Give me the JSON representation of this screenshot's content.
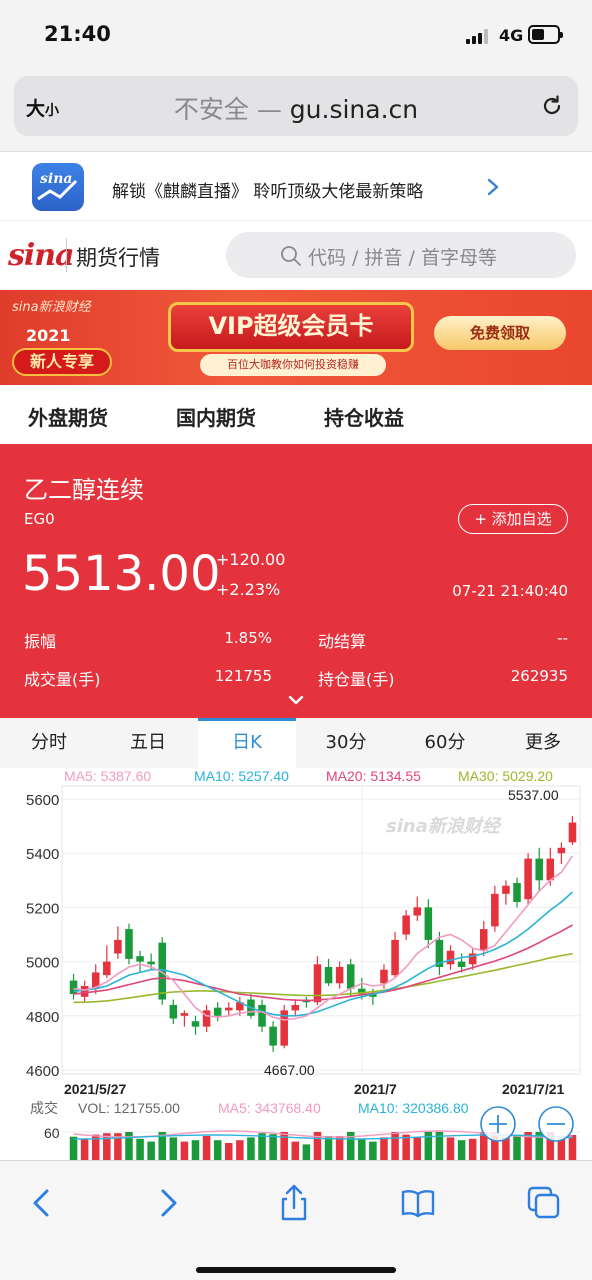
{
  "status_bar": {
    "time": "21:40",
    "network": "4G"
  },
  "browser": {
    "text_size_label": "大",
    "text_size_small": "小",
    "url_insecure": "不安全 —",
    "url_domain": "gu.sina.cn"
  },
  "promo_banner": {
    "text": "解锁《麒麟直播》 聆听顶级大佬最新策略"
  },
  "site_header": {
    "logo": "sina",
    "title": "期货行情",
    "search_placeholder": "代码 / 拼音 / 首字母等"
  },
  "ad_banner": {
    "brand": "sina新浪财经",
    "year": "2021",
    "newbie": "新人专享",
    "headline": "VIP超级会员卡",
    "subline": "百位大咖教你如何投资稳赚",
    "cta": "免费领取"
  },
  "main_tabs": [
    "外盘期货",
    "国内期货",
    "持仓收益"
  ],
  "quote": {
    "name": "乙二醇连续",
    "code": "EG0",
    "add_watch": "+ 添加自选",
    "price": "5513.00",
    "change": "+120.00",
    "change_pct": "+2.23%",
    "datetime": "07-21 21:40:40",
    "amplitude_label": "振幅",
    "amplitude": "1.85%",
    "settle_label": "动结算",
    "settle": "--",
    "volume_label": "成交量(手)",
    "volume": "121755",
    "open_interest_label": "持仓量(手)",
    "open_interest": "262935"
  },
  "period_tabs": [
    "分时",
    "五日",
    "日K",
    "30分",
    "60分",
    "更多"
  ],
  "active_period": "日K",
  "colors": {
    "up": "#e5333d",
    "down": "#1a9a3a",
    "ma5": "#f29ac0",
    "ma10": "#2bb3d8",
    "ma20": "#e0457b",
    "ma30": "#9ab82a",
    "accent": "#2f8dd8"
  },
  "chart_data": {
    "type": "candlestick",
    "ma_legend": [
      {
        "name": "MA5",
        "text": "MA5: 5387.60"
      },
      {
        "name": "MA10",
        "text": "MA10: 5257.40"
      },
      {
        "name": "MA20",
        "text": "MA20: 5134.55"
      },
      {
        "name": "MA30",
        "text": "MA30: 5029.20"
      }
    ],
    "y_ticks": [
      5600,
      5400,
      5200,
      5000,
      4800,
      4600
    ],
    "ylim": [
      4600,
      5650
    ],
    "x_labels": [
      "2021/5/27",
      "2021/7",
      "2021/7/21"
    ],
    "max_label": "5537.00",
    "min_label": "4667.00",
    "watermark": "sina新浪财经",
    "candles": [
      [
        4930,
        4880,
        4955,
        4860
      ],
      [
        4870,
        4910,
        4930,
        4850
      ],
      [
        4900,
        4960,
        4990,
        4880
      ],
      [
        4950,
        5000,
        5060,
        4940
      ],
      [
        5030,
        5080,
        5130,
        5010
      ],
      [
        5120,
        5010,
        5140,
        4990
      ],
      [
        5020,
        5000,
        5040,
        4960
      ],
      [
        5000,
        4990,
        5030,
        4970
      ],
      [
        5070,
        4860,
        5090,
        4840
      ],
      [
        4840,
        4790,
        4860,
        4770
      ],
      [
        4800,
        4810,
        4820,
        4760
      ],
      [
        4780,
        4760,
        4800,
        4730
      ],
      [
        4760,
        4820,
        4840,
        4740
      ],
      [
        4830,
        4800,
        4850,
        4780
      ],
      [
        4820,
        4830,
        4850,
        4800
      ],
      [
        4820,
        4850,
        4870,
        4800
      ],
      [
        4860,
        4800,
        4880,
        4790
      ],
      [
        4840,
        4760,
        4860,
        4740
      ],
      [
        4760,
        4690,
        4780,
        4667
      ],
      [
        4690,
        4820,
        4840,
        4680
      ],
      [
        4820,
        4840,
        4860,
        4800
      ],
      [
        4860,
        4850,
        4870,
        4830
      ],
      [
        4850,
        4990,
        5020,
        4840
      ],
      [
        4980,
        4920,
        5010,
        4910
      ],
      [
        4920,
        4980,
        5000,
        4900
      ],
      [
        4990,
        4900,
        5010,
        4870
      ],
      [
        4900,
        4880,
        4940,
        4860
      ],
      [
        4880,
        4870,
        4900,
        4840
      ],
      [
        4920,
        4970,
        4990,
        4900
      ],
      [
        4950,
        5080,
        5110,
        4940
      ],
      [
        5100,
        5170,
        5190,
        5080
      ],
      [
        5170,
        5200,
        5240,
        5150
      ],
      [
        5200,
        5080,
        5230,
        5050
      ],
      [
        5080,
        4980,
        5110,
        4950
      ],
      [
        4990,
        5040,
        5060,
        4970
      ],
      [
        5000,
        4980,
        5030,
        4960
      ],
      [
        4990,
        5030,
        5050,
        4970
      ],
      [
        5040,
        5120,
        5150,
        5020
      ],
      [
        5130,
        5250,
        5280,
        5110
      ],
      [
        5250,
        5280,
        5300,
        5210
      ],
      [
        5290,
        5220,
        5310,
        5200
      ],
      [
        5230,
        5380,
        5400,
        5210
      ],
      [
        5380,
        5300,
        5420,
        5260
      ],
      [
        5300,
        5380,
        5420,
        5280
      ],
      [
        5400,
        5420,
        5440,
        5360
      ],
      [
        5440,
        5513,
        5537,
        5430
      ]
    ],
    "ma5": [
      4900,
      4895,
      4905,
      4925,
      4955,
      4980,
      4990,
      4980,
      4960,
      4930,
      4880,
      4830,
      4800,
      4795,
      4800,
      4810,
      4815,
      4815,
      4795,
      4785,
      4790,
      4800,
      4830,
      4860,
      4880,
      4900,
      4920,
      4910,
      4915,
      4940,
      4980,
      5030,
      5060,
      5090,
      5100,
      5080,
      5050,
      5040,
      5060,
      5110,
      5160,
      5210,
      5260,
      5300,
      5330,
      5390
    ],
    "ma10": [
      4890,
      4895,
      4900,
      4910,
      4930,
      4950,
      4960,
      4970,
      4970,
      4960,
      4950,
      4930,
      4910,
      4890,
      4870,
      4850,
      4830,
      4815,
      4805,
      4800,
      4800,
      4805,
      4815,
      4830,
      4845,
      4860,
      4870,
      4880,
      4890,
      4905,
      4925,
      4950,
      4975,
      4995,
      5005,
      5015,
      5020,
      5030,
      5045,
      5065,
      5090,
      5120,
      5155,
      5190,
      5220,
      5257
    ],
    "ma20": [
      4880,
      4885,
      4890,
      4895,
      4905,
      4915,
      4925,
      4935,
      4940,
      4935,
      4930,
      4920,
      4910,
      4900,
      4890,
      4880,
      4875,
      4870,
      4865,
      4860,
      4858,
      4856,
      4858,
      4862,
      4866,
      4872,
      4878,
      4882,
      4888,
      4896,
      4906,
      4918,
      4930,
      4942,
      4954,
      4966,
      4978,
      4990,
      5002,
      5016,
      5032,
      5050,
      5070,
      5092,
      5112,
      5135
    ],
    "ma30": [
      4850,
      4850,
      4852,
      4855,
      4860,
      4866,
      4872,
      4878,
      4884,
      4888,
      4890,
      4892,
      4892,
      4890,
      4888,
      4886,
      4884,
      4882,
      4880,
      4878,
      4876,
      4875,
      4875,
      4876,
      4878,
      4881,
      4885,
      4889,
      4894,
      4900,
      4906,
      4913,
      4920,
      4928,
      4936,
      4944,
      4952,
      4960,
      4968,
      4977,
      4986,
      4995,
      5004,
      5014,
      5022,
      5029
    ],
    "volume_panel": {
      "label": "成交",
      "vol_text": "VOL: 121755.00",
      "ma5_text": "MA5: 343768.40",
      "ma10_text": "MA10: 320386.80",
      "y_tick": "60"
    }
  }
}
